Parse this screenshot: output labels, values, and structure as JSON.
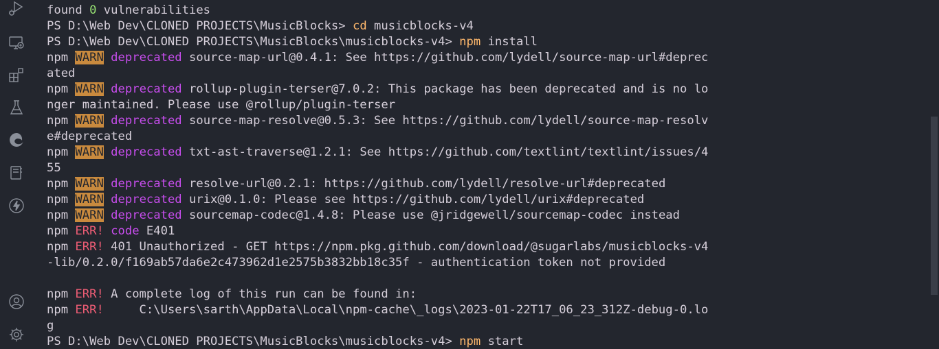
{
  "colors": {
    "background": "#23262e",
    "text": "#d5ced9",
    "number": "#96e072",
    "command": "#ffb86c",
    "warn_bg": "#c98a3e",
    "deprecated": "#c74ded",
    "err": "#ee5d75",
    "icon": "#8a8f99"
  },
  "activity_bar": {
    "icons": [
      "run-debug-icon",
      "remote-explorer-icon",
      "extensions-icon",
      "testing-icon",
      "edge-devtools-icon",
      "bookmarks-icon",
      "thunder-client-icon",
      "accounts-icon",
      "manage-gear-icon"
    ]
  },
  "terminal": {
    "lines": [
      [
        {
          "t": "found ",
          "c": "text"
        },
        {
          "t": "0",
          "c": "number"
        },
        {
          "t": " vulnerabilities",
          "c": "text"
        }
      ],
      [
        {
          "t": "PS D:\\Web Dev\\CLONED PROJECTS\\MusicBlocks> ",
          "c": "text"
        },
        {
          "t": "cd",
          "c": "command"
        },
        {
          "t": " musicblocks-v4",
          "c": "text"
        }
      ],
      [
        {
          "t": "PS D:\\Web Dev\\CLONED PROJECTS\\MusicBlocks\\musicblocks-v4> ",
          "c": "text"
        },
        {
          "t": "npm",
          "c": "command"
        },
        {
          "t": " install",
          "c": "text"
        }
      ],
      [
        {
          "t": "npm ",
          "c": "text"
        },
        {
          "t": "WARN",
          "c": "warn"
        },
        {
          "t": " ",
          "c": "text"
        },
        {
          "t": "deprecated",
          "c": "deprecated"
        },
        {
          "t": " source-map-url@0.4.1: See https://github.com/lydell/source-map-url#deprec",
          "c": "text"
        }
      ],
      [
        {
          "t": "ated",
          "c": "text"
        }
      ],
      [
        {
          "t": "npm ",
          "c": "text"
        },
        {
          "t": "WARN",
          "c": "warn"
        },
        {
          "t": " ",
          "c": "text"
        },
        {
          "t": "deprecated",
          "c": "deprecated"
        },
        {
          "t": " rollup-plugin-terser@7.0.2: This package has been deprecated and is no lo",
          "c": "text"
        }
      ],
      [
        {
          "t": "nger maintained. Please use @rollup/plugin-terser",
          "c": "text"
        }
      ],
      [
        {
          "t": "npm ",
          "c": "text"
        },
        {
          "t": "WARN",
          "c": "warn"
        },
        {
          "t": " ",
          "c": "text"
        },
        {
          "t": "deprecated",
          "c": "deprecated"
        },
        {
          "t": " source-map-resolve@0.5.3: See https://github.com/lydell/source-map-resolv",
          "c": "text"
        }
      ],
      [
        {
          "t": "e#deprecated",
          "c": "text"
        }
      ],
      [
        {
          "t": "npm ",
          "c": "text"
        },
        {
          "t": "WARN",
          "c": "warn"
        },
        {
          "t": " ",
          "c": "text"
        },
        {
          "t": "deprecated",
          "c": "deprecated"
        },
        {
          "t": " txt-ast-traverse@1.2.1: See https://github.com/textlint/textlint/issues/4",
          "c": "text"
        }
      ],
      [
        {
          "t": "55",
          "c": "text"
        }
      ],
      [
        {
          "t": "npm ",
          "c": "text"
        },
        {
          "t": "WARN",
          "c": "warn"
        },
        {
          "t": " ",
          "c": "text"
        },
        {
          "t": "deprecated",
          "c": "deprecated"
        },
        {
          "t": " resolve-url@0.2.1: https://github.com/lydell/resolve-url#deprecated",
          "c": "text"
        }
      ],
      [
        {
          "t": "npm ",
          "c": "text"
        },
        {
          "t": "WARN",
          "c": "warn"
        },
        {
          "t": " ",
          "c": "text"
        },
        {
          "t": "deprecated",
          "c": "deprecated"
        },
        {
          "t": " urix@0.1.0: Please see https://github.com/lydell/urix#deprecated",
          "c": "text"
        }
      ],
      [
        {
          "t": "npm ",
          "c": "text"
        },
        {
          "t": "WARN",
          "c": "warn"
        },
        {
          "t": " ",
          "c": "text"
        },
        {
          "t": "deprecated",
          "c": "deprecated"
        },
        {
          "t": " sourcemap-codec@1.4.8: Please use @jridgewell/sourcemap-codec instead",
          "c": "text"
        }
      ],
      [
        {
          "t": "npm ",
          "c": "text"
        },
        {
          "t": "ERR!",
          "c": "err"
        },
        {
          "t": " ",
          "c": "text"
        },
        {
          "t": "code",
          "c": "deprecated"
        },
        {
          "t": " E401",
          "c": "text"
        }
      ],
      [
        {
          "t": "npm ",
          "c": "text"
        },
        {
          "t": "ERR!",
          "c": "err"
        },
        {
          "t": " 401 Unauthorized - GET https://npm.pkg.github.com/download/@sugarlabs/musicblocks-v4",
          "c": "text"
        }
      ],
      [
        {
          "t": "-lib/0.2.0/f169ab57da6e2c473962d1e2575b3832bb18c35f - authentication token not provided",
          "c": "text"
        }
      ],
      [
        {
          "t": "",
          "c": "text"
        }
      ],
      [
        {
          "t": "npm ",
          "c": "text"
        },
        {
          "t": "ERR!",
          "c": "err"
        },
        {
          "t": " A complete log of this run can be found in:",
          "c": "text"
        }
      ],
      [
        {
          "t": "npm ",
          "c": "text"
        },
        {
          "t": "ERR!",
          "c": "err"
        },
        {
          "t": "     C:\\Users\\sarth\\AppData\\Local\\npm-cache\\_logs\\2023-01-22T17_06_23_312Z-debug-0.lo",
          "c": "text"
        }
      ],
      [
        {
          "t": "g",
          "c": "text"
        }
      ],
      [
        {
          "t": "PS D:\\Web Dev\\CLONED PROJECTS\\MusicBlocks\\musicblocks-v4> ",
          "c": "text"
        },
        {
          "t": "npm",
          "c": "command"
        },
        {
          "t": " start",
          "c": "text"
        }
      ]
    ]
  }
}
